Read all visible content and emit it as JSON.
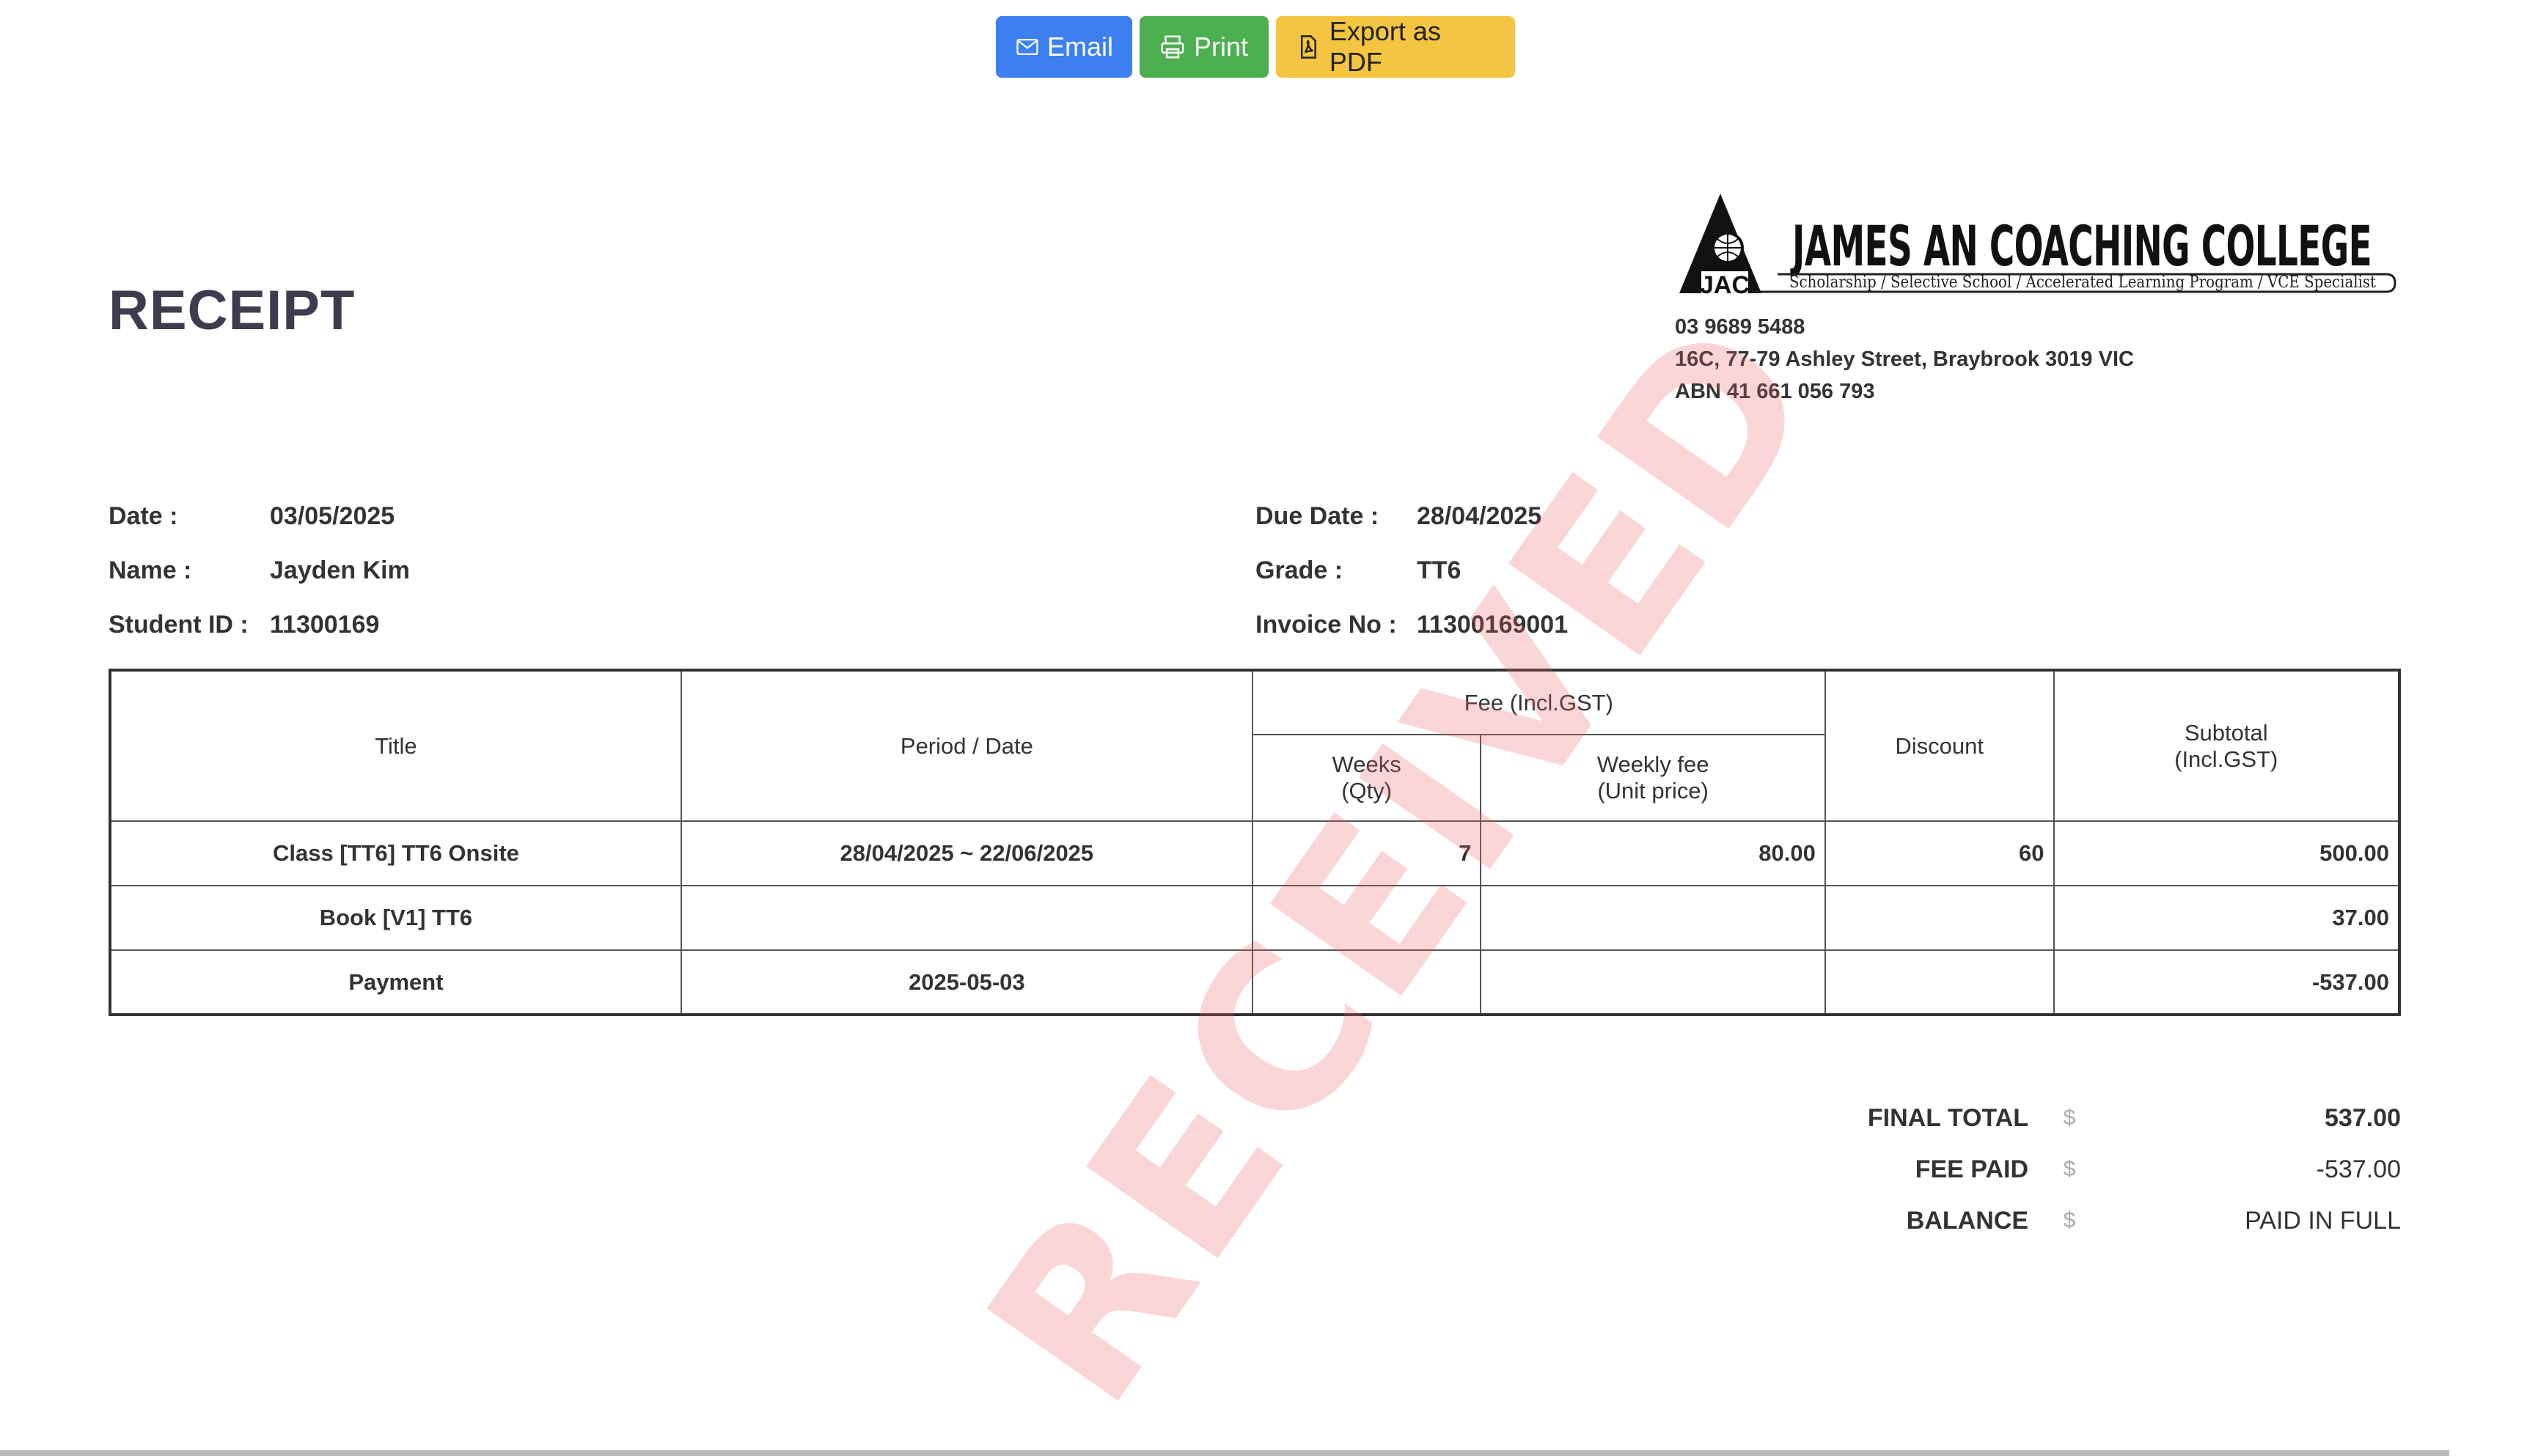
{
  "toolbar": {
    "email_label": "Email",
    "print_label": "Print",
    "pdf_label": "Export as PDF"
  },
  "title": "RECEIPT",
  "company": {
    "name": "JAMES AN COACHING COLLEGE",
    "abbr": "JAC",
    "tagline": "Scholarship / Selective School / Accelerated Learning Program / VCE Specialist",
    "phone": "03 9689 5488",
    "address": "16C, 77-79 Ashley Street, Braybrook 3019 VIC",
    "abn": "ABN 41 661 056 793"
  },
  "info": {
    "date_label": "Date :",
    "date": "03/05/2025",
    "name_label": "Name :",
    "name": "Jayden Kim",
    "student_id_label": "Student ID :",
    "student_id": "11300169",
    "due_date_label": "Due Date :",
    "due_date": "28/04/2025",
    "grade_label": "Grade :",
    "grade": "TT6",
    "invoice_label": "Invoice No :",
    "invoice_no": "11300169001"
  },
  "table": {
    "headers": {
      "title": "Title",
      "period": "Period / Date",
      "fee": "Fee (Incl.GST)",
      "weeks_1": "Weeks",
      "weeks_2": "(Qty)",
      "weekly_1": "Weekly fee",
      "weekly_2": "(Unit price)",
      "discount": "Discount",
      "subtotal_1": "Subtotal",
      "subtotal_2": "(Incl.GST)"
    },
    "rows": [
      {
        "title": "Class [TT6] TT6 Onsite",
        "period": "28/04/2025 ~ 22/06/2025",
        "weeks": "7",
        "weekly_fee": "80.00",
        "discount": "60",
        "subtotal": "500.00"
      },
      {
        "title": "Book [V1] TT6",
        "period": "",
        "weeks": "",
        "weekly_fee": "",
        "discount": "",
        "subtotal": "37.00"
      },
      {
        "title": "Payment",
        "period": "2025-05-03",
        "weeks": "",
        "weekly_fee": "",
        "discount": "",
        "subtotal": "-537.00"
      }
    ]
  },
  "totals": {
    "currency": "$",
    "final_total_label": "FINAL TOTAL",
    "final_total": "537.00",
    "fee_paid_label": "FEE PAID",
    "fee_paid": "-537.00",
    "balance_label": "BALANCE",
    "balance": "PAID IN FULL"
  },
  "stamp": "RECEIVED",
  "colors": {
    "email": "#3b7ff0",
    "print": "#4caf50",
    "pdf": "#f5c542",
    "stamp": "#eb5a5a"
  }
}
